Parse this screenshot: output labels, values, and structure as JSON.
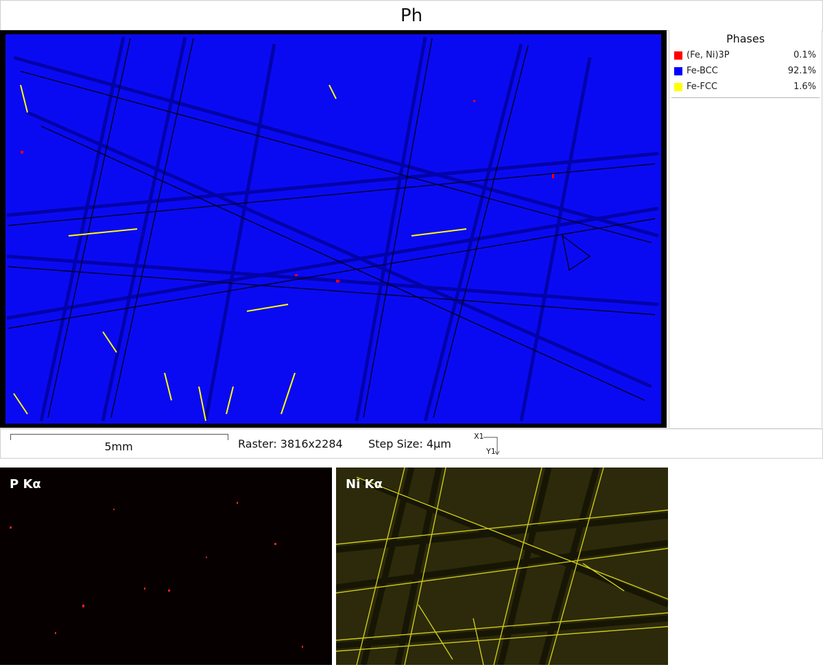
{
  "map_title": "Ph",
  "legend": {
    "heading": "Phases",
    "phases": [
      {
        "name": "(Fe, Ni)3P",
        "percent": "0.1%",
        "color": "#ff0000"
      },
      {
        "name": "Fe-BCC",
        "percent": "92.1%",
        "color": "#0000ff"
      },
      {
        "name": "Fe-FCC",
        "percent": "1.6%",
        "color": "#ffff00"
      }
    ]
  },
  "info": {
    "scale_label": "5mm",
    "raster": "Raster: 3816x2284",
    "step_size": "Step Size: 4µm",
    "axis_x": "X1",
    "axis_y": "Y1"
  },
  "eds_maps": [
    {
      "label": "P Kα",
      "color": "#ff1a1a"
    },
    {
      "label": "Ni Kα",
      "color": "#d6d21a"
    }
  ]
}
